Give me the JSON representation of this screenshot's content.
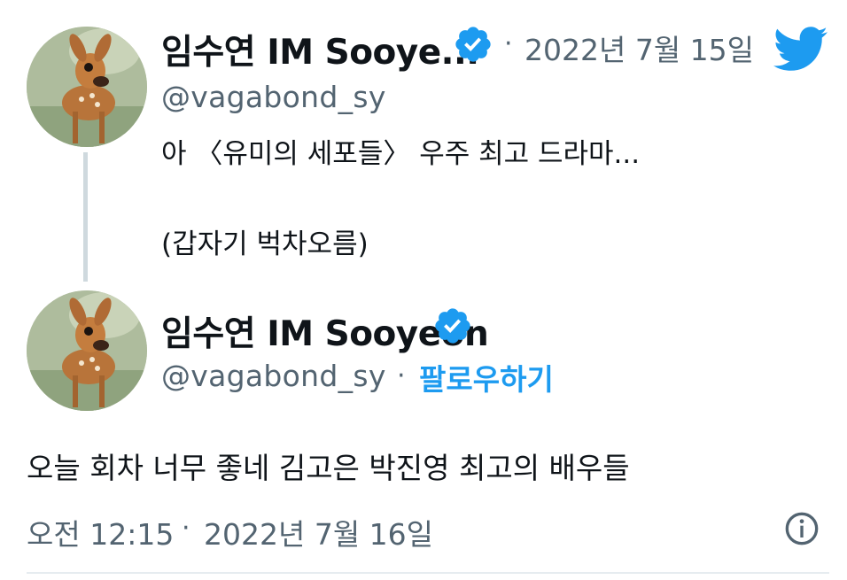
{
  "quoted_tweet": {
    "display_name": "임수연 IM Sooye...",
    "handle": "@vagabond_sy",
    "separator": "·",
    "date": "2022년 7월 15일",
    "text_line1": "아 〈유미의 세포들〉 우주 최고 드라마...",
    "text_line2": "(갑자기 벅차오름)"
  },
  "main_tweet": {
    "display_name": "임수연 IM Sooyeon",
    "handle": "@vagabond_sy",
    "separator": "·",
    "follow_label": "팔로우하기",
    "text": "오늘 회차 너무 좋네 김고은 박진영 최고의 배우들",
    "time": "오전 12:15",
    "time_separator": "·",
    "date": "2022년 7월 16일"
  },
  "icons": {
    "verified": "verified-badge-icon",
    "logo": "twitter-bird-icon",
    "info": "info-icon",
    "avatar": "bambi-avatar"
  },
  "colors": {
    "twitter_blue": "#1d9bf0",
    "muted_text": "#536471",
    "thread_line": "#cfd9de"
  }
}
